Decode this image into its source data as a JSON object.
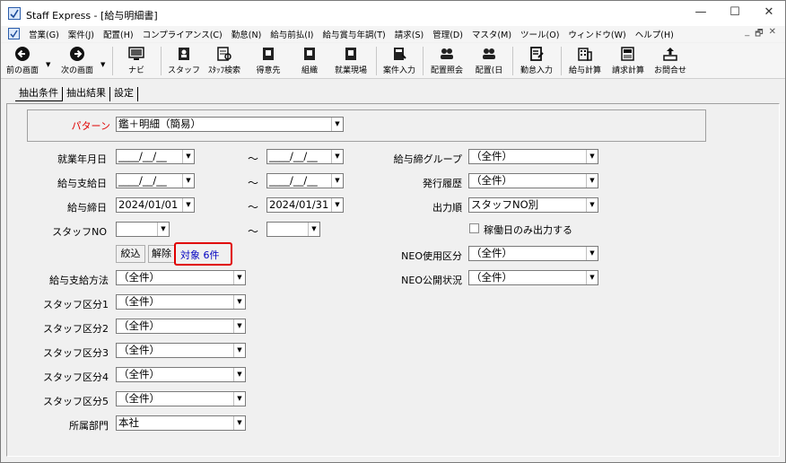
{
  "window": {
    "title": "Staff Express - [給与明細書]",
    "minimize": "—",
    "maximize": "☐",
    "close": "✕"
  },
  "menu": {
    "items": [
      "営業(G)",
      "案件(J)",
      "配置(H)",
      "コンプライアンス(C)",
      "勤怠(N)",
      "給与前払(I)",
      "給与賞与年調(T)",
      "請求(S)",
      "管理(D)",
      "マスタ(M)",
      "ツール(O)",
      "ウィンドウ(W)",
      "ヘルプ(H)"
    ],
    "mdi_min": "_",
    "mdi_restore": "🗗",
    "mdi_close": "✕"
  },
  "toolbar": {
    "back": "前の画面",
    "forward": "次の画面",
    "navi": "ナビ",
    "staff": "スタッフ",
    "staff_search": "ｽﾀｯﾌ検索",
    "client": "得意先",
    "organization": "組織",
    "worksite": "就業現場",
    "case_input": "案件入力",
    "placement_inquiry": "配置照会",
    "placement_day": "配置(日",
    "attendance_input": "勤怠入力",
    "payroll_calc": "給与計算",
    "billing_calc": "請求計算",
    "inquiry": "お問合せ"
  },
  "tabs": [
    "抽出条件",
    "抽出結果",
    "設定"
  ],
  "form": {
    "pattern_label": "パターン",
    "pattern_value": "鑑＋明細（簡易）",
    "work_date_label": "就業年月日",
    "work_date_from": "____/__/__",
    "work_date_to": "____/__/__",
    "pay_date_label": "給与支給日",
    "pay_date_from": "____/__/__",
    "pay_date_to": "____/__/__",
    "close_date_label": "給与締日",
    "close_date_from": "2024/01/01",
    "close_date_to": "2024/01/31",
    "staff_no_label": "スタッフNO",
    "staff_no_from": "",
    "staff_no_to": "",
    "tilde": "～",
    "filter_button": "絞込",
    "clear_button": "解除",
    "count_text": "対象 6件",
    "pay_method_label": "給与支給方法",
    "pay_method_value": "（全件）",
    "staff_cat1_label": "スタッフ区分1",
    "staff_cat1_value": "（全件）",
    "staff_cat2_label": "スタッフ区分2",
    "staff_cat2_value": "（全件）",
    "staff_cat3_label": "スタッフ区分3",
    "staff_cat3_value": "（全件）",
    "staff_cat4_label": "スタッフ区分4",
    "staff_cat4_value": "（全件）",
    "staff_cat5_label": "スタッフ区分5",
    "staff_cat5_value": "（全件）",
    "department_label": "所属部門",
    "department_value": "本社",
    "close_group_label": "給与締グループ",
    "close_group_value": "（全件）",
    "issue_history_label": "発行履歴",
    "issue_history_value": "（全件）",
    "output_order_label": "出力順",
    "output_order_value": "スタッフNO別",
    "work_days_only_label": "稼働日のみ出力する",
    "neo_use_label": "NEO使用区分",
    "neo_use_value": "（全件）",
    "neo_public_label": "NEO公開状況",
    "neo_public_value": "（全件）"
  },
  "colors": {
    "pattern_label": "#e00000",
    "highlight_border": "#e00000",
    "count_text": "#0000c0"
  }
}
